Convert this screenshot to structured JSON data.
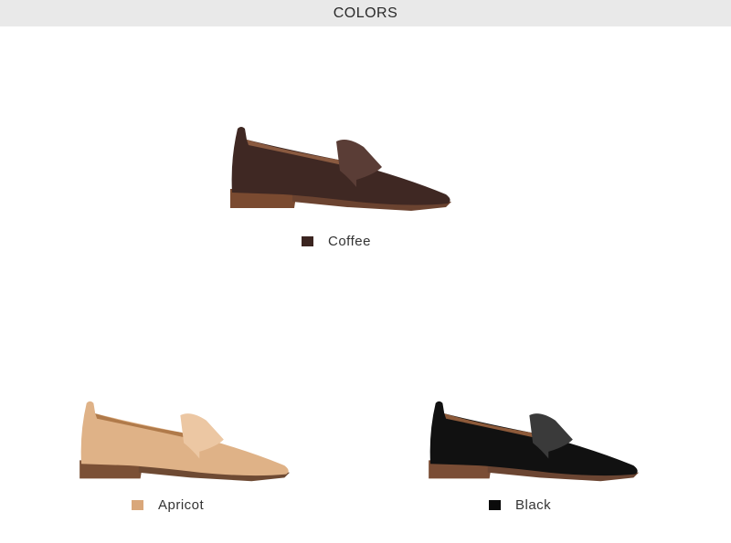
{
  "header": {
    "title": "COLORS"
  },
  "variants": [
    {
      "label": "Coffee",
      "swatch_color": "#3b2520",
      "upper_color": "#3f2823",
      "upper_highlight": "#5a3d36",
      "sole_color": "#6b4330",
      "heel_color": "#7a4a30",
      "lining_color": "#8a5a40",
      "icon": "loafer-icon"
    },
    {
      "label": "Apricot",
      "swatch_color": "#d9a77a",
      "upper_color": "#dfb287",
      "upper_highlight": "#ecc7a3",
      "sole_color": "#6e4a33",
      "heel_color": "#7b5035",
      "lining_color": "#b07a4a",
      "icon": "loafer-icon"
    },
    {
      "label": "Black",
      "swatch_color": "#0b0b0b",
      "upper_color": "#111111",
      "upper_highlight": "#3a3a3a",
      "sole_color": "#6b4532",
      "heel_color": "#7a4d35",
      "lining_color": "#8d5a3a",
      "icon": "loafer-icon"
    }
  ]
}
